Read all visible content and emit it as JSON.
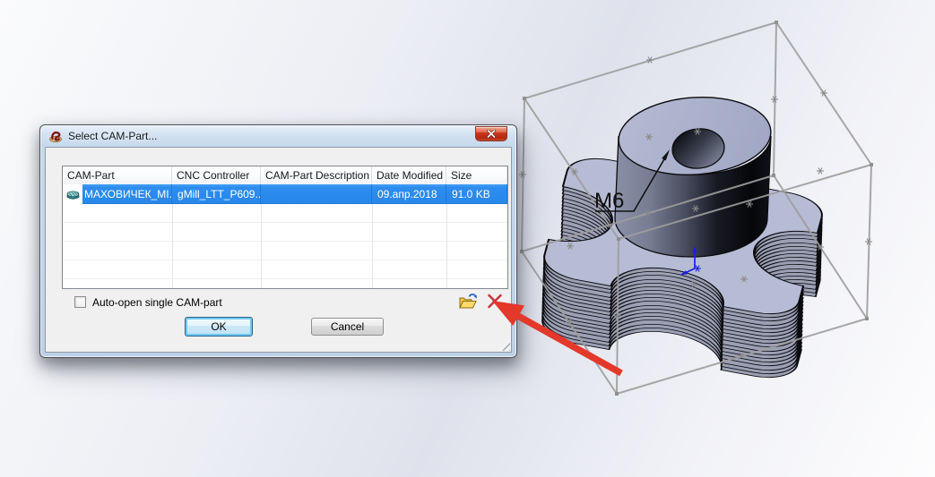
{
  "window": {
    "title": "Select CAM-Part..."
  },
  "table": {
    "columns": [
      "CAM-Part",
      "CNC Controller",
      "CAM-Part Description",
      "Date Modified",
      "Size"
    ],
    "row": {
      "cam_part": "МАХОВИЧЕК_MI...",
      "cnc_controller": "gMill_LTT_P609...",
      "cam_part_description": "",
      "date_modified": "09.апр.2018",
      "size": "91.0 KB"
    }
  },
  "options": {
    "auto_open_label": "Auto-open single CAM-part",
    "auto_open_checked": false
  },
  "actions": {
    "ok": "OK",
    "cancel": "Cancel"
  },
  "viewport": {
    "annotation": "M6"
  },
  "icons": {
    "app": "solidcam-logo",
    "row_part": "cam-part-icon",
    "open_folder": "open-folder-icon",
    "delete": "delete-x-icon",
    "close": "close-icon"
  },
  "colors": {
    "selection_blue": "#2E8DEF",
    "arrow_red": "#E4382B",
    "stock_box_gray": "#9B9B9B",
    "model_lavender": "#AEB4CE"
  }
}
